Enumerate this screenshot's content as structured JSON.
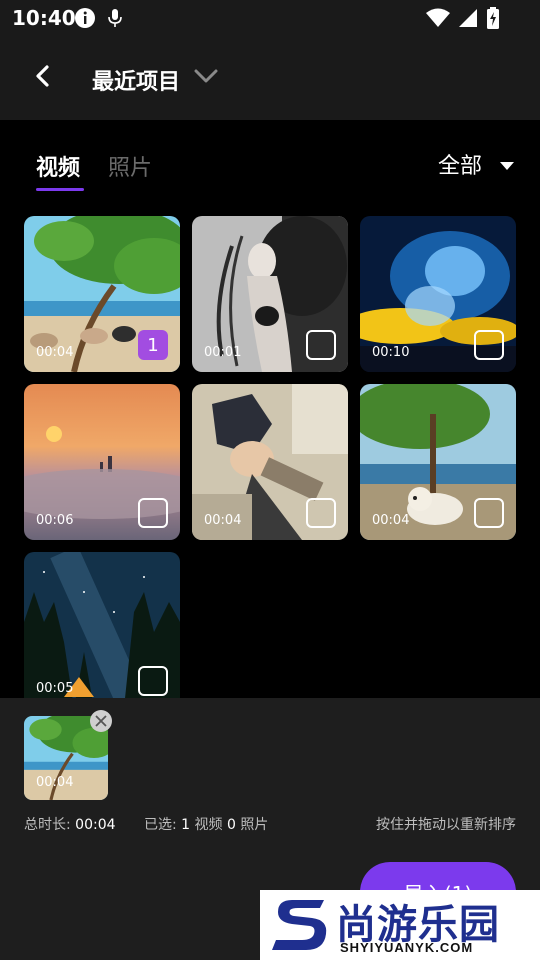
{
  "status": {
    "time": "10:40"
  },
  "header": {
    "title": "最近项目"
  },
  "tabs": {
    "video": "视频",
    "photo": "照片",
    "filter": "全部"
  },
  "media": [
    {
      "duration": "00:04",
      "selected_index": "1"
    },
    {
      "duration": "00:01",
      "selected_index": ""
    },
    {
      "duration": "00:10",
      "selected_index": ""
    },
    {
      "duration": "00:06",
      "selected_index": ""
    },
    {
      "duration": "00:04",
      "selected_index": ""
    },
    {
      "duration": "00:04",
      "selected_index": ""
    },
    {
      "duration": "00:05",
      "selected_index": ""
    }
  ],
  "selection": {
    "thumb_duration": "00:04",
    "total_label": "总时长:",
    "total_value": "00:04",
    "selected_label": "已选:",
    "video_count": "1",
    "video_label": "视频",
    "photo_count": "0",
    "photo_label": "照片",
    "hint": "按住并拖动以重新排序"
  },
  "import_button": "导入(1)",
  "watermark": {
    "brand": "尚游乐园",
    "url": "SHYIYUANYK.COM"
  },
  "colors": {
    "accent": "#7c3aed",
    "badge": "#a24de1",
    "header_bg": "#1a1a1a",
    "panel_bg": "#1e1e1e"
  },
  "icons": {
    "status": [
      "info-icon",
      "mic-icon",
      "wifi-icon",
      "signal-icon",
      "battery-charging-icon"
    ],
    "header": [
      "back-arrow-icon",
      "chevron-down-icon"
    ],
    "filter": "dropdown-triangle-icon",
    "remove": "close-icon"
  }
}
